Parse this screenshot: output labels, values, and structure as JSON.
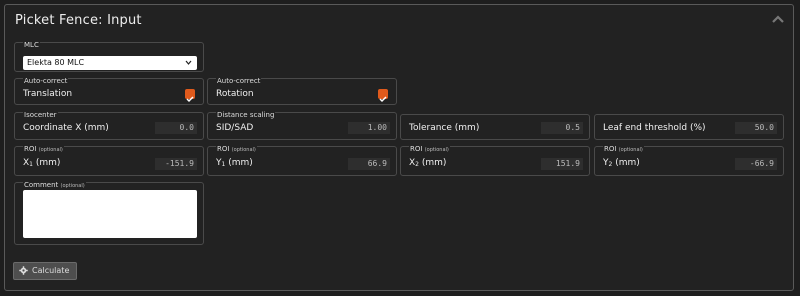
{
  "panel": {
    "title": "Picket Fence: Input"
  },
  "mlc": {
    "legend": "MLC",
    "selected": "Elekta 80 MLC"
  },
  "autocorrect_translation": {
    "legend": "Auto-correct",
    "label": "Translation",
    "checked": true
  },
  "autocorrect_rotation": {
    "legend": "Auto-correct",
    "label": "Rotation",
    "checked": true
  },
  "isocenter": {
    "legend": "Isocenter",
    "label": "Coordinate X (mm)",
    "value": "0.0"
  },
  "distance": {
    "legend": "Distance scaling",
    "label": "SID/SAD",
    "value": "1.00"
  },
  "tolerance": {
    "label": "Tolerance (mm)",
    "value": "0.5"
  },
  "leaf_threshold": {
    "label": "Leaf end threshold (%)",
    "value": "50.0"
  },
  "roi_x1": {
    "legend": "ROI",
    "legend_note": "(optional)",
    "label": "X",
    "sub": "1",
    "unit": " (mm)",
    "value": "-151.9"
  },
  "roi_y1": {
    "legend": "ROI",
    "legend_note": "(optional)",
    "label": "Y",
    "sub": "1",
    "unit": " (mm)",
    "value": "66.9"
  },
  "roi_x2": {
    "legend": "ROI",
    "legend_note": "(optional)",
    "label": "X",
    "sub": "2",
    "unit": " (mm)",
    "value": "151.9"
  },
  "roi_y2": {
    "legend": "ROI",
    "legend_note": "(optional)",
    "label": "Y",
    "sub": "2",
    "unit": " (mm)",
    "value": "-66.9"
  },
  "comment": {
    "legend": "Comment",
    "legend_note": "(optional)",
    "value": ""
  },
  "calculate": {
    "label": "Calculate",
    "icon": "gear-icon"
  },
  "colors": {
    "accent": "#e05a1c",
    "background": "#222222",
    "border": "#4a4a4a"
  }
}
